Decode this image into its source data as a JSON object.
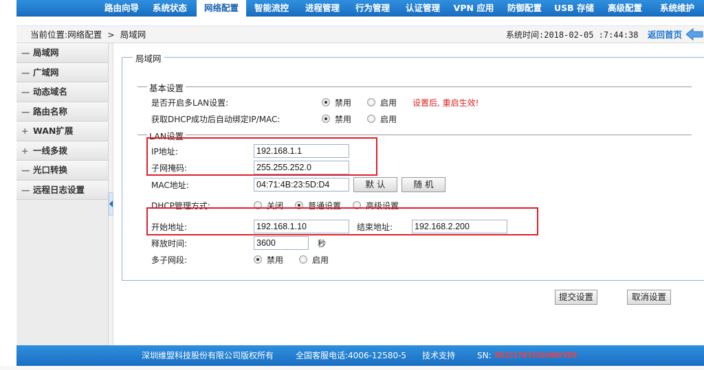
{
  "nav": {
    "items": [
      {
        "label": "路由向导"
      },
      {
        "label": "系统状态"
      },
      {
        "label": "网络配置",
        "active": true
      },
      {
        "label": "智能流控"
      },
      {
        "label": "进程管理"
      },
      {
        "label": "行为管理"
      },
      {
        "label": "认证管理"
      },
      {
        "label": "VPN 应用"
      },
      {
        "label": "防御配置"
      },
      {
        "label": "USB 存储"
      },
      {
        "label": "高级配置"
      },
      {
        "label": "系统维护"
      }
    ]
  },
  "breadcrumb": {
    "prefix": "当前位置:",
    "section": "网络配置",
    "separator": ">",
    "page": "局域网"
  },
  "system_time": "系统时间:2018-02-05 :7:44:38",
  "home_link": "返回首页",
  "sidebar": {
    "items": [
      {
        "prefix": "—",
        "label": "局域网"
      },
      {
        "prefix": "—",
        "label": "广域网"
      },
      {
        "prefix": "—",
        "label": "动态域名"
      },
      {
        "prefix": "—",
        "label": "路由名称"
      },
      {
        "prefix": "+",
        "label": "WAN扩展"
      },
      {
        "prefix": "+",
        "label": "一线多拨"
      },
      {
        "prefix": "—",
        "label": "光口转换"
      },
      {
        "prefix": "—",
        "label": "远程日志设置"
      }
    ]
  },
  "main": {
    "legend": "局域网",
    "basic": {
      "title": "基本设置",
      "multi_lan_label": "是否开启多LAN设置:",
      "multi_lan_options": [
        "禁用",
        "启用"
      ],
      "multi_lan_selected": "禁用",
      "restart_warning": "设置后, 重启生效!",
      "dhcp_bind_label": "获取DHCP成功后自动绑定IP/MAC:",
      "dhcp_bind_options": [
        "禁用",
        "启用"
      ],
      "dhcp_bind_selected": "禁用"
    },
    "lan": {
      "title": "LAN设置",
      "ip_label": "IP地址:",
      "ip_value": "192.168.1.1",
      "mask_label": "子网掩码:",
      "mask_value": "255.255.252.0",
      "mac_label": "MAC地址:",
      "mac_value": "04:71:4B:23:5D:D4",
      "default_button": "默 认",
      "random_button": "随 机",
      "dhcp_mode_label": "DHCP管理方式:",
      "dhcp_mode_options": [
        "关闭",
        "普通设置",
        "高级设置"
      ],
      "dhcp_mode_selected": "普通设置",
      "start_label": "开始地址:",
      "start_value": "192.168.1.10",
      "end_label": "结束地址:",
      "end_value": "192.168.2.200",
      "lease_label": "释放时间:",
      "lease_value": "3600",
      "lease_unit": "秒",
      "multi_subnet_label": "多子网段:",
      "multi_subnet_options": [
        "禁用",
        "启用"
      ],
      "multi_subnet_selected": "禁用"
    },
    "submit_button": "提交设置",
    "cancel_button": "取消设置"
  },
  "footer": {
    "company": "深圳维盟科技股份有限公司版权所有",
    "hotline": "全国客服电话:4006-12580-5",
    "support": "技术支持",
    "sn_label": "SN:",
    "sn_value": "RG121703256480F2D9"
  },
  "colors": {
    "nav_blue": "#1a6fc2",
    "highlight_red": "#e01e2a",
    "warning_red": "#e01e1e"
  }
}
